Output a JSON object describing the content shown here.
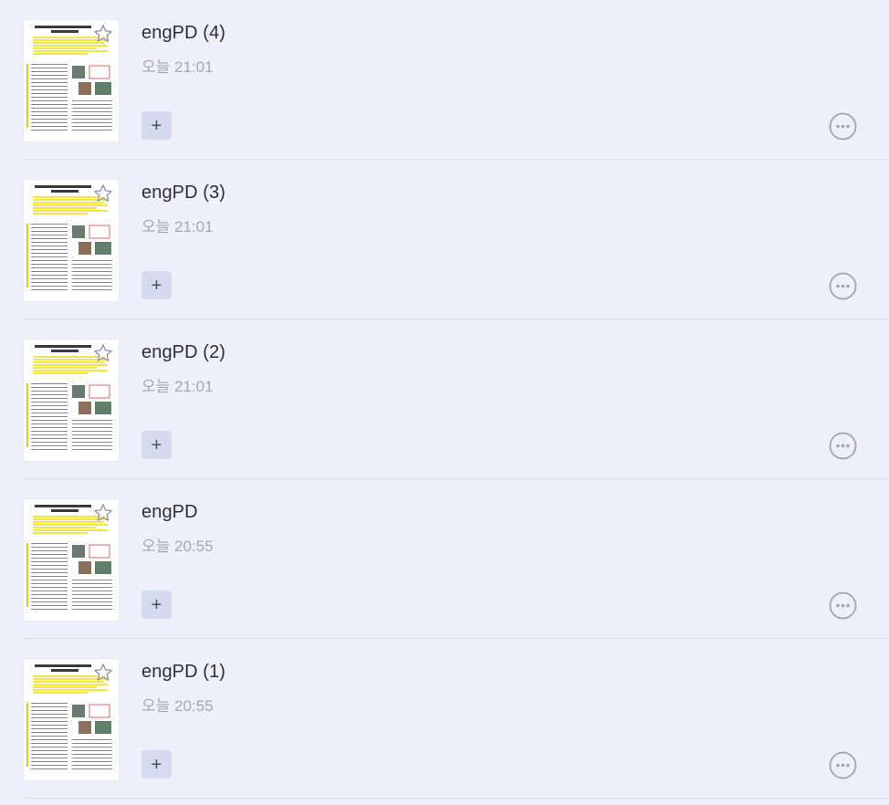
{
  "documents": [
    {
      "title": "engPD (4)",
      "time": "오늘 21:01",
      "add_label": "+"
    },
    {
      "title": "engPD (3)",
      "time": "오늘 21:01",
      "add_label": "+"
    },
    {
      "title": "engPD (2)",
      "time": "오늘 21:01",
      "add_label": "+"
    },
    {
      "title": "engPD",
      "time": "오늘 20:55",
      "add_label": "+"
    },
    {
      "title": "engPD (1)",
      "time": "오늘 20:55",
      "add_label": "+"
    }
  ],
  "icons": {
    "thumbnail": "document-thumbnail-icon",
    "favorite": "star-icon",
    "more": "more-options-icon"
  },
  "colors": {
    "background": "#eeeff8",
    "add_button": "#d6daf0",
    "more_icon": "#9fa3b3",
    "highlight": "#f3e44a"
  }
}
